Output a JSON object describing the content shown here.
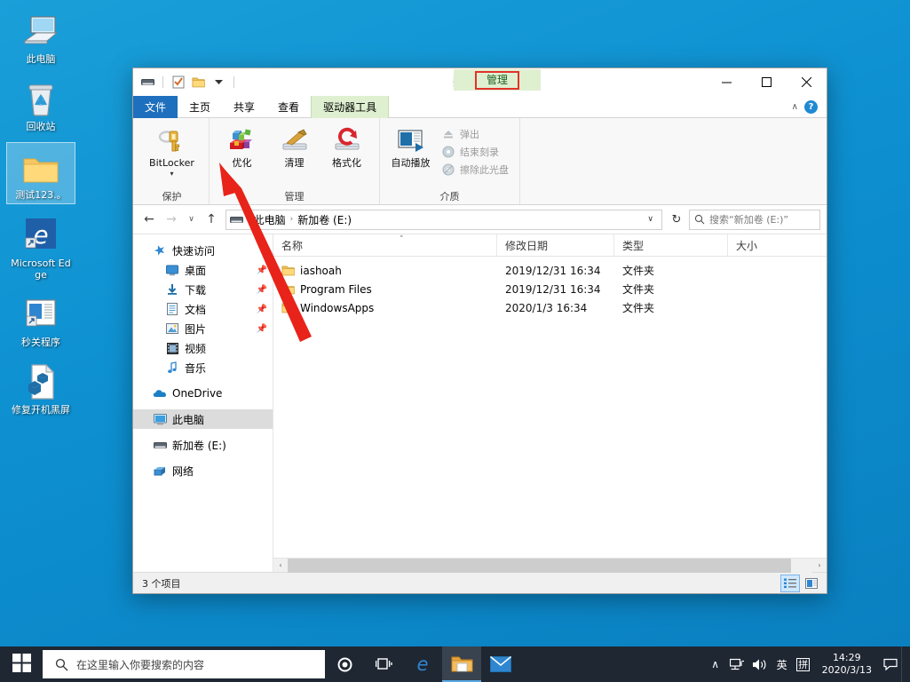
{
  "desktop": {
    "icons": [
      {
        "label": "此电脑",
        "icon": "this-pc-icon",
        "selected": false
      },
      {
        "label": "回收站",
        "icon": "recycle-bin-icon",
        "selected": false
      },
      {
        "label": "测试123.。",
        "icon": "folder-icon",
        "selected": true
      },
      {
        "label": "Microsoft Edge",
        "icon": "edge-icon",
        "selected": false
      },
      {
        "label": "秒关程序",
        "icon": "window-shortcut-icon",
        "selected": false
      },
      {
        "label": "修复开机黑屏",
        "icon": "script-file-icon",
        "selected": false
      }
    ]
  },
  "window": {
    "title": "新加卷 (E:)",
    "quick_access": [
      {
        "name": "drive-icon",
        "glyph": "drive"
      },
      {
        "name": "properties-icon",
        "glyph": "properties"
      },
      {
        "name": "new-folder-icon",
        "glyph": "folder"
      },
      {
        "name": "customize-qat-caret-icon",
        "glyph": "caret"
      }
    ],
    "caption": {
      "minimize": "—",
      "maximize": "☐",
      "close": "✕"
    },
    "contextual_tab_header": "管理",
    "ribbon_collapse": "∧",
    "help": "?"
  },
  "tabs": [
    {
      "label": "文件",
      "kind": "file"
    },
    {
      "label": "主页",
      "kind": "normal"
    },
    {
      "label": "共享",
      "kind": "normal"
    },
    {
      "label": "查看",
      "kind": "normal"
    },
    {
      "label": "驱动器工具",
      "kind": "contextual"
    }
  ],
  "ribbon": {
    "groups": [
      {
        "title": "保护",
        "big_buttons": [
          {
            "label": "BitLocker",
            "icon": "bitlocker-icon",
            "has_caret": true,
            "caret": "▾"
          }
        ],
        "small_buttons": []
      },
      {
        "title": "管理",
        "big_buttons": [
          {
            "label": "优化",
            "icon": "optimize-drive-icon",
            "has_caret": false
          },
          {
            "label": "清理",
            "icon": "disk-cleanup-icon",
            "has_caret": false
          },
          {
            "label": "格式化",
            "icon": "format-drive-icon",
            "has_caret": false
          }
        ],
        "small_buttons": []
      },
      {
        "title": "介质",
        "big_buttons": [
          {
            "label": "自动播放",
            "icon": "autoplay-icon",
            "has_caret": false
          }
        ],
        "small_buttons": [
          {
            "label": "弹出",
            "icon": "eject-icon",
            "disabled": true
          },
          {
            "label": "结束刻录",
            "icon": "finish-burning-icon",
            "disabled": true
          },
          {
            "label": "擦除此光盘",
            "icon": "erase-disc-icon",
            "disabled": true
          }
        ]
      }
    ]
  },
  "address_bar": {
    "back": "←",
    "forward": "→",
    "recent": "∨",
    "up": "↑",
    "drive_icon": "drive-icon",
    "breadcrumbs": [
      "此电脑",
      "新加卷 (E:)"
    ],
    "separator": "›",
    "dropdown_caret": "∨",
    "refresh": "↻"
  },
  "search": {
    "icon": "search-icon",
    "placeholder": "搜索“新加卷 (E:)”"
  },
  "nav_pane": {
    "items": [
      {
        "label": "快速访问",
        "icon": "quick-access-star-icon",
        "indent": false,
        "pinned": false,
        "selected": false
      },
      {
        "label": "桌面",
        "icon": "desktop-icon",
        "indent": true,
        "pinned": true,
        "selected": false
      },
      {
        "label": "下载",
        "icon": "downloads-icon",
        "indent": true,
        "pinned": true,
        "selected": false
      },
      {
        "label": "文档",
        "icon": "documents-icon",
        "indent": true,
        "pinned": true,
        "selected": false
      },
      {
        "label": "图片",
        "icon": "pictures-icon",
        "indent": true,
        "pinned": true,
        "selected": false
      },
      {
        "label": "视频",
        "icon": "videos-icon",
        "indent": true,
        "pinned": false,
        "selected": false
      },
      {
        "label": "音乐",
        "icon": "music-icon",
        "indent": true,
        "pinned": false,
        "selected": false
      },
      {
        "label": "OneDrive",
        "icon": "onedrive-icon",
        "indent": false,
        "pinned": false,
        "selected": false,
        "gap_before": true
      },
      {
        "label": "此电脑",
        "icon": "this-pc-icon",
        "indent": false,
        "pinned": false,
        "selected": true,
        "gap_before": true
      },
      {
        "label": "新加卷 (E:)",
        "icon": "drive-icon",
        "indent": false,
        "pinned": false,
        "selected": false,
        "gap_before": true
      },
      {
        "label": "网络",
        "icon": "network-icon",
        "indent": false,
        "pinned": false,
        "selected": false,
        "gap_before": true
      }
    ]
  },
  "file_list": {
    "columns": [
      "名称",
      "修改日期",
      "类型",
      "大小"
    ],
    "sort_column": "名称",
    "sort_arrow": "˄",
    "rows": [
      {
        "name": "iashoah",
        "date": "2019/12/31 16:34",
        "type": "文件夹",
        "size": "",
        "icon": "folder-icon"
      },
      {
        "name": "Program Files",
        "date": "2019/12/31 16:34",
        "type": "文件夹",
        "size": "",
        "icon": "folder-icon"
      },
      {
        "name": "WindowsApps",
        "date": "2020/1/3 16:34",
        "type": "文件夹",
        "size": "",
        "icon": "folder-icon"
      }
    ]
  },
  "scrollbar": {
    "left_arrow": "‹",
    "right_arrow": "›"
  },
  "status_bar": {
    "text": "3 个项目",
    "views": [
      {
        "name": "details-view-button",
        "active": true
      },
      {
        "name": "large-icons-view-button",
        "active": false
      }
    ]
  },
  "taskbar": {
    "start": "start-icon",
    "search_placeholder": "在这里输入你要搜索的内容",
    "search_icon": "search-icon",
    "apps": [
      {
        "name": "cortana-icon",
        "active": false
      },
      {
        "name": "task-view-icon",
        "active": false
      },
      {
        "name": "edge-icon",
        "active": false
      },
      {
        "name": "file-explorer-icon",
        "active": true
      },
      {
        "name": "mail-icon",
        "active": false
      }
    ],
    "tray": [
      {
        "name": "show-hidden-icons-chevron",
        "glyph": "∧"
      },
      {
        "name": "network-icon",
        "glyph": "network"
      },
      {
        "name": "volume-icon",
        "glyph": "volume"
      },
      {
        "name": "ime-language-icon",
        "glyph": "英"
      },
      {
        "name": "ime-pinyin-icon",
        "glyph": "拼"
      }
    ],
    "clock": {
      "time": "14:29",
      "date": "2020/3/13"
    },
    "action_center": "action-center-icon"
  },
  "annotation": {
    "color": "#e8231a",
    "type": "arrow",
    "points_to": "优化"
  }
}
